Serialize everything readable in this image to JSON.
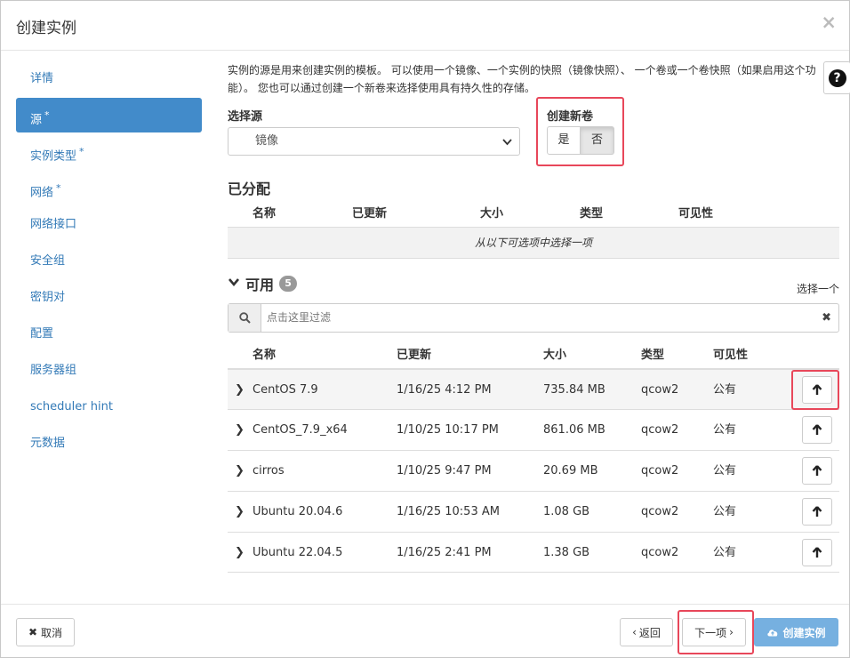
{
  "modal": {
    "title": "创建实例",
    "close_symbol": "×"
  },
  "sidebar": {
    "items": [
      {
        "label": "详情",
        "required": false,
        "active": false
      },
      {
        "label": "源",
        "required": true,
        "active": true
      },
      {
        "label": "实例类型",
        "required": true,
        "active": false
      },
      {
        "label": "网络",
        "required": true,
        "active": false
      },
      {
        "label": "网络接口",
        "required": false,
        "active": false
      },
      {
        "label": "安全组",
        "required": false,
        "active": false
      },
      {
        "label": "密钥对",
        "required": false,
        "active": false
      },
      {
        "label": "配置",
        "required": false,
        "active": false
      },
      {
        "label": "服务器组",
        "required": false,
        "active": false
      },
      {
        "label": "scheduler hint",
        "required": false,
        "active": false
      },
      {
        "label": "元数据",
        "required": false,
        "active": false
      }
    ],
    "required_marker": "*"
  },
  "source": {
    "intro": "实例的源是用来创建实例的模板。 可以使用一个镜像、一个实例的快照（镜像快照）、 一个卷或一个卷快照（如果启用这个功能）。 您也可以通过创建一个新卷来选择使用具有持久性的存储。",
    "select_label": "选择源",
    "select_value": "镜像",
    "new_volume_label": "创建新卷",
    "new_volume_yes": "是",
    "new_volume_no": "否",
    "help_symbol": "?"
  },
  "allocated": {
    "title": "已分配",
    "columns": [
      "名称",
      "已更新",
      "大小",
      "类型",
      "可见性"
    ],
    "empty_text": "从以下可选项中选择一项"
  },
  "available": {
    "title": "可用",
    "count": "5",
    "choose_one": "选择一个",
    "filter_placeholder": "点击这里过滤",
    "columns": [
      "名称",
      "已更新",
      "大小",
      "类型",
      "可见性"
    ],
    "rows": [
      {
        "name": "CentOS 7.9",
        "updated": "1/16/25 4:12 PM",
        "size": "735.84 MB",
        "type": "qcow2",
        "visibility": "公有"
      },
      {
        "name": "CentOS_7.9_x64",
        "updated": "1/10/25 10:17 PM",
        "size": "861.06 MB",
        "type": "qcow2",
        "visibility": "公有"
      },
      {
        "name": "cirros",
        "updated": "1/10/25 9:47 PM",
        "size": "20.69 MB",
        "type": "qcow2",
        "visibility": "公有"
      },
      {
        "name": "Ubuntu 20.04.6",
        "updated": "1/16/25 10:53 AM",
        "size": "1.08 GB",
        "type": "qcow2",
        "visibility": "公有"
      },
      {
        "name": "Ubuntu 22.04.5",
        "updated": "1/16/25 2:41 PM",
        "size": "1.38 GB",
        "type": "qcow2",
        "visibility": "公有"
      }
    ]
  },
  "footer": {
    "cancel": "取消",
    "back": "返回",
    "next": "下一项",
    "create": "创建实例"
  },
  "colors": {
    "accent": "#428bca",
    "highlight_box": "#e8475a",
    "primary_disabled": "#76b0e0"
  }
}
